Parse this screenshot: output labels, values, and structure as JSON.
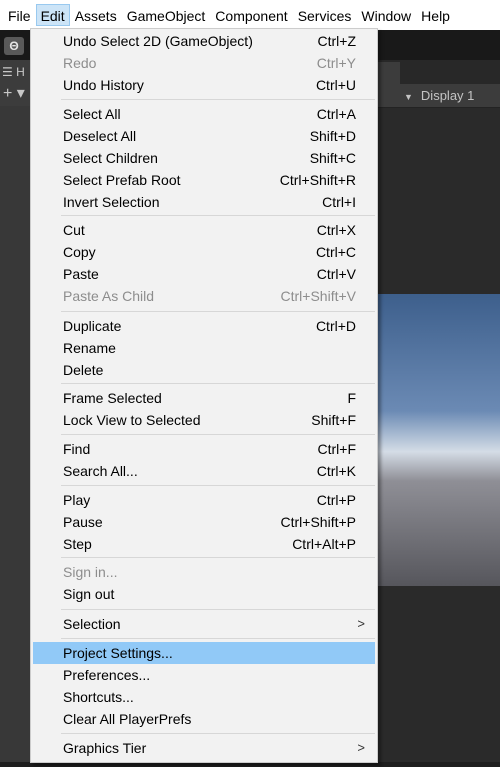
{
  "menubar": {
    "items": [
      "File",
      "Edit",
      "Assets",
      "GameObject",
      "Component",
      "Services",
      "Window",
      "Help"
    ]
  },
  "background": {
    "account_glyph": "Θ",
    "hierarchy_tab": "☰ H",
    "add_button": "+ ▾",
    "display_label": "Display 1",
    "dropdown_arrow": "▼"
  },
  "edit_menu": {
    "items": [
      {
        "label": "Undo Select 2D (GameObject)",
        "shortcut": "Ctrl+Z"
      },
      {
        "label": "Redo",
        "shortcut": "Ctrl+Y",
        "disabled": true
      },
      {
        "label": "Undo History",
        "shortcut": "Ctrl+U"
      },
      {
        "label": "Select All",
        "shortcut": "Ctrl+A"
      },
      {
        "label": "Deselect All",
        "shortcut": "Shift+D"
      },
      {
        "label": "Select Children",
        "shortcut": "Shift+C"
      },
      {
        "label": "Select Prefab Root",
        "shortcut": "Ctrl+Shift+R"
      },
      {
        "label": "Invert Selection",
        "shortcut": "Ctrl+I"
      },
      {
        "label": "Cut",
        "shortcut": "Ctrl+X"
      },
      {
        "label": "Copy",
        "shortcut": "Ctrl+C"
      },
      {
        "label": "Paste",
        "shortcut": "Ctrl+V"
      },
      {
        "label": "Paste As Child",
        "shortcut": "Ctrl+Shift+V",
        "disabled": true
      },
      {
        "label": "Duplicate",
        "shortcut": "Ctrl+D"
      },
      {
        "label": "Rename",
        "shortcut": ""
      },
      {
        "label": "Delete",
        "shortcut": ""
      },
      {
        "label": "Frame Selected",
        "shortcut": "F"
      },
      {
        "label": "Lock View to Selected",
        "shortcut": "Shift+F"
      },
      {
        "label": "Find",
        "shortcut": "Ctrl+F"
      },
      {
        "label": "Search All...",
        "shortcut": "Ctrl+K"
      },
      {
        "label": "Play",
        "shortcut": "Ctrl+P"
      },
      {
        "label": "Pause",
        "shortcut": "Ctrl+Shift+P"
      },
      {
        "label": "Step",
        "shortcut": "Ctrl+Alt+P"
      },
      {
        "label": "Sign in...",
        "shortcut": "",
        "disabled": true
      },
      {
        "label": "Sign out",
        "shortcut": ""
      },
      {
        "label": "Selection",
        "shortcut": "",
        "submenu": ">"
      },
      {
        "label": "Project Settings...",
        "shortcut": "",
        "highlighted": true
      },
      {
        "label": "Preferences...",
        "shortcut": ""
      },
      {
        "label": "Shortcuts...",
        "shortcut": ""
      },
      {
        "label": "Clear All PlayerPrefs",
        "shortcut": ""
      },
      {
        "label": "Graphics Tier",
        "shortcut": "",
        "submenu": ">"
      }
    ]
  },
  "colors": {
    "menu_background": "#f2f2f2",
    "highlight": "#91c9f7",
    "active_menubar_item": "#cce4f7",
    "disabled_text": "#8d8d8d",
    "editor_dark": "#383838"
  }
}
